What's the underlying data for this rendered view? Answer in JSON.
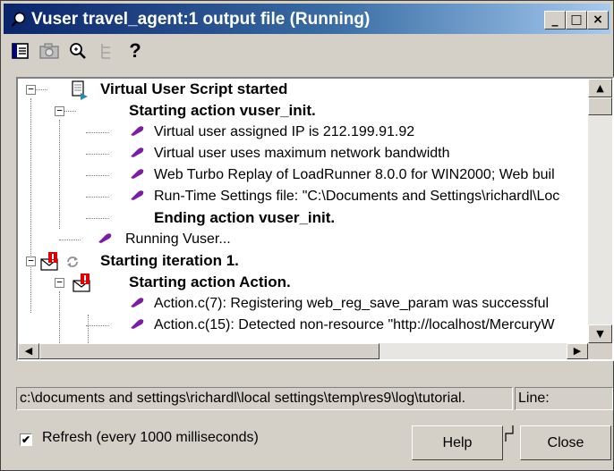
{
  "window": {
    "title": "Vuser travel_agent:1 output file (Running)",
    "controls": {
      "minimize": "_",
      "maximize": "□",
      "close": "×"
    }
  },
  "toolbar": {
    "icons": [
      "display-icon",
      "camera-icon",
      "find-icon",
      "tree-icon",
      "help-icon"
    ],
    "help_label": "?"
  },
  "tree": {
    "rows": [
      {
        "text": "Virtual User Script started",
        "bold": true,
        "icon": "script-start-icon"
      },
      {
        "text": "Starting action vuser_init.",
        "bold": true,
        "icon": "none"
      },
      {
        "text": "Virtual user assigned IP is 212.199.91.92",
        "bold": false,
        "icon": "message-icon"
      },
      {
        "text": "Virtual user uses maximum network bandwidth",
        "bold": false,
        "icon": "message-icon"
      },
      {
        "text": "Web Turbo Replay of LoadRunner 8.0.0 for WIN2000; Web buil",
        "bold": false,
        "icon": "message-icon"
      },
      {
        "text": "Run-Time Settings file: \"C:\\Documents and Settings\\richardl\\Loc",
        "bold": false,
        "icon": "message-icon"
      },
      {
        "text": "Ending action vuser_init.",
        "bold": true,
        "icon": "none"
      },
      {
        "text": "Running Vuser...",
        "bold": false,
        "icon": "message-icon"
      },
      {
        "text": "Starting iteration 1.",
        "bold": true,
        "icon": "iteration-icon"
      },
      {
        "text": "Starting action Action.",
        "bold": true,
        "icon": "error-mail-icon"
      },
      {
        "text": "Action.c(7): Registering web_reg_save_param was successful",
        "bold": false,
        "icon": "message-icon"
      },
      {
        "text": "Action.c(15): Detected non-resource \"http://localhost/MercuryW",
        "bold": false,
        "icon": "message-icon"
      }
    ]
  },
  "status_bar": {
    "path": "c:\\documents and settings\\richardl\\local settings\\temp\\res9\\log\\tutorial.",
    "line_label": "Line:"
  },
  "footer": {
    "refresh_checked": true,
    "refresh_mark": "✔",
    "refresh_label": "Refresh (every 1000 milliseconds)",
    "help_button": "Help",
    "close_button": "Close"
  },
  "colors": {
    "title_gradient_start": "#0a246a",
    "title_gradient_end": "#a6caf0",
    "message_icon": "#7a1fa2",
    "error_icon": "#e00000"
  }
}
